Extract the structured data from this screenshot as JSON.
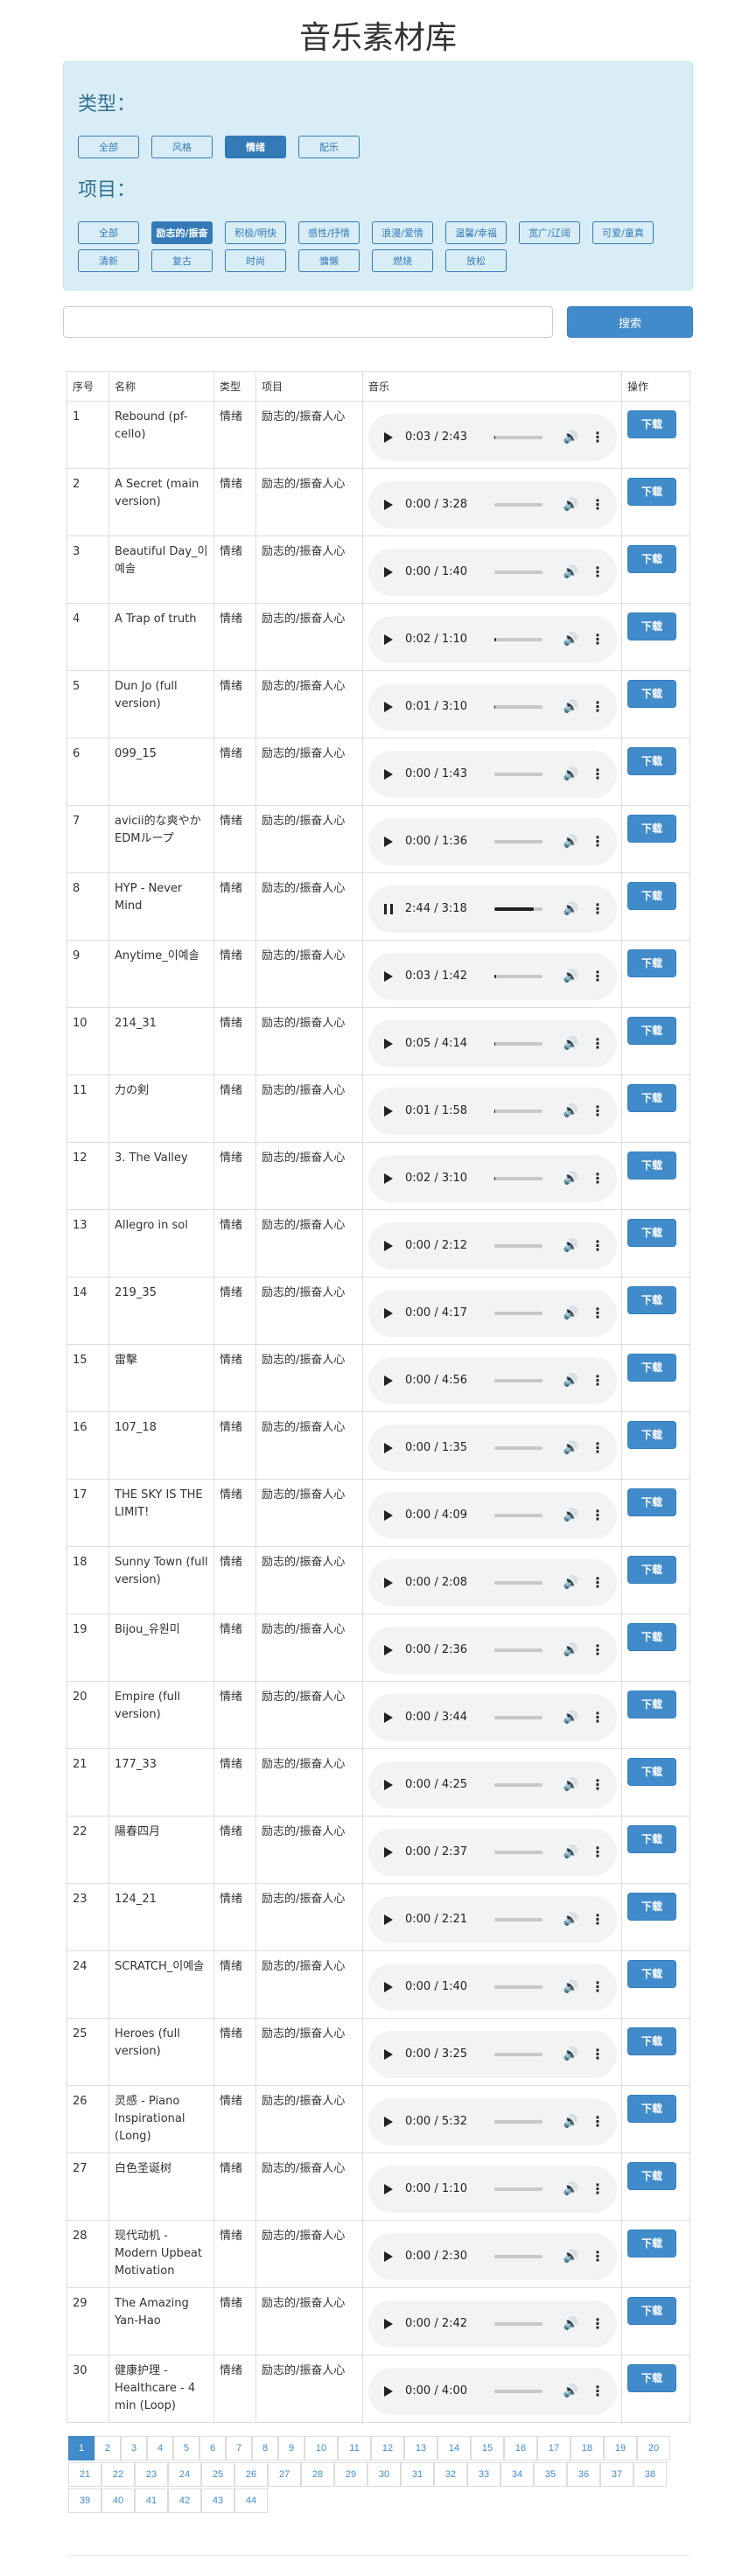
{
  "title": "音乐素材库",
  "filters": {
    "type_heading": "类型：",
    "type_chips": [
      {
        "label": "全部",
        "active": false
      },
      {
        "label": "风格",
        "active": false
      },
      {
        "label": "情绪",
        "active": true
      },
      {
        "label": "配乐",
        "active": false
      }
    ],
    "item_heading": "项目：",
    "item_chips_row1": [
      {
        "label": "全部",
        "active": false
      },
      {
        "label": "励志的/振奋",
        "active": true
      },
      {
        "label": "积极/明快",
        "active": false
      },
      {
        "label": "感性/抒情",
        "active": false
      },
      {
        "label": "浪漫/爱情",
        "active": false
      },
      {
        "label": "温馨/幸福",
        "active": false
      },
      {
        "label": "宽广/辽阔",
        "active": false
      },
      {
        "label": "可爱/童真",
        "active": false
      }
    ],
    "item_chips_row2": [
      {
        "label": "清新",
        "active": false
      },
      {
        "label": "复古",
        "active": false
      },
      {
        "label": "时尚",
        "active": false
      },
      {
        "label": "慵懒",
        "active": false
      },
      {
        "label": "燃烧",
        "active": false
      },
      {
        "label": "放松",
        "active": false
      }
    ]
  },
  "search": {
    "placeholder": "",
    "button_label": "搜索"
  },
  "table": {
    "headers": [
      "序号",
      "名称",
      "类型",
      "项目",
      "音乐",
      "操作"
    ],
    "download_label": "下载",
    "rows": [
      {
        "no": "1",
        "name": "Rebound (pf-cello)",
        "type": "情绪",
        "item": "励志的/振奋人心",
        "time": "0:03 / 2:43",
        "progress": 0.02,
        "playing": false
      },
      {
        "no": "2",
        "name": "A Secret (main version)",
        "type": "情绪",
        "item": "励志的/振奋人心",
        "time": "0:00 / 3:28",
        "progress": 0,
        "playing": false
      },
      {
        "no": "3",
        "name": "Beautiful Day_이예솔",
        "type": "情绪",
        "item": "励志的/振奋人心",
        "time": "0:00 / 1:40",
        "progress": 0,
        "playing": false
      },
      {
        "no": "4",
        "name": "A Trap of truth",
        "type": "情绪",
        "item": "励志的/振奋人心",
        "time": "0:02 / 1:10",
        "progress": 0.03,
        "playing": false
      },
      {
        "no": "5",
        "name": "Dun Jo (full version)",
        "type": "情绪",
        "item": "励志的/振奋人心",
        "time": "0:01 / 3:10",
        "progress": 0.01,
        "playing": false
      },
      {
        "no": "6",
        "name": "099_15",
        "type": "情绪",
        "item": "励志的/振奋人心",
        "time": "0:00 / 1:43",
        "progress": 0,
        "playing": false
      },
      {
        "no": "7",
        "name": "avicii的な爽やかEDMループ",
        "type": "情绪",
        "item": "励志的/振奋人心",
        "time": "0:00 / 1:36",
        "progress": 0,
        "playing": false
      },
      {
        "no": "8",
        "name": "HYP - Never Mind",
        "type": "情绪",
        "item": "励志的/振奋人心",
        "time": "2:44 / 3:18",
        "progress": 0.83,
        "playing": true
      },
      {
        "no": "9",
        "name": "Anytime_이예솔",
        "type": "情绪",
        "item": "励志的/振奋人心",
        "time": "0:03 / 1:42",
        "progress": 0.03,
        "playing": false
      },
      {
        "no": "10",
        "name": "214_31",
        "type": "情绪",
        "item": "励志的/振奋人心",
        "time": "0:05 / 4:14",
        "progress": 0.02,
        "playing": false
      },
      {
        "no": "11",
        "name": "力の剣",
        "type": "情绪",
        "item": "励志的/振奋人心",
        "time": "0:01 / 1:58",
        "progress": 0.01,
        "playing": false
      },
      {
        "no": "12",
        "name": "3. The Valley",
        "type": "情绪",
        "item": "励志的/振奋人心",
        "time": "0:02 / 3:10",
        "progress": 0.01,
        "playing": false
      },
      {
        "no": "13",
        "name": "Allegro in sol",
        "type": "情绪",
        "item": "励志的/振奋人心",
        "time": "0:00 / 2:12",
        "progress": 0,
        "playing": false
      },
      {
        "no": "14",
        "name": "219_35",
        "type": "情绪",
        "item": "励志的/振奋人心",
        "time": "0:00 / 4:17",
        "progress": 0,
        "playing": false
      },
      {
        "no": "15",
        "name": "雷擊",
        "type": "情绪",
        "item": "励志的/振奋人心",
        "time": "0:00 / 4:56",
        "progress": 0,
        "playing": false
      },
      {
        "no": "16",
        "name": "107_18",
        "type": "情绪",
        "item": "励志的/振奋人心",
        "time": "0:00 / 1:35",
        "progress": 0,
        "playing": false
      },
      {
        "no": "17",
        "name": "THE SKY IS THE LIMIT!",
        "type": "情绪",
        "item": "励志的/振奋人心",
        "time": "0:00 / 4:09",
        "progress": 0,
        "playing": false
      },
      {
        "no": "18",
        "name": "Sunny Town (full version)",
        "type": "情绪",
        "item": "励志的/振奋人心",
        "time": "0:00 / 2:08",
        "progress": 0,
        "playing": false
      },
      {
        "no": "19",
        "name": "Bijou_유원미",
        "type": "情绪",
        "item": "励志的/振奋人心",
        "time": "0:00 / 2:36",
        "progress": 0,
        "playing": false
      },
      {
        "no": "20",
        "name": "Empire (full version)",
        "type": "情绪",
        "item": "励志的/振奋人心",
        "time": "0:00 / 3:44",
        "progress": 0,
        "playing": false
      },
      {
        "no": "21",
        "name": "177_33",
        "type": "情绪",
        "item": "励志的/振奋人心",
        "time": "0:00 / 4:25",
        "progress": 0,
        "playing": false
      },
      {
        "no": "22",
        "name": "陽春四月",
        "type": "情绪",
        "item": "励志的/振奋人心",
        "time": "0:00 / 2:37",
        "progress": 0,
        "playing": false
      },
      {
        "no": "23",
        "name": "124_21",
        "type": "情绪",
        "item": "励志的/振奋人心",
        "time": "0:00 / 2:21",
        "progress": 0,
        "playing": false
      },
      {
        "no": "24",
        "name": "SCRATCH_이예솔",
        "type": "情绪",
        "item": "励志的/振奋人心",
        "time": "0:00 / 1:40",
        "progress": 0,
        "playing": false
      },
      {
        "no": "25",
        "name": "Heroes (full version)",
        "type": "情绪",
        "item": "励志的/振奋人心",
        "time": "0:00 / 3:25",
        "progress": 0,
        "playing": false
      },
      {
        "no": "26",
        "name": "灵感 - Piano Inspirational (Long)",
        "type": "情绪",
        "item": "励志的/振奋人心",
        "time": "0:00 / 5:32",
        "progress": 0,
        "playing": false
      },
      {
        "no": "27",
        "name": "白色圣诞树",
        "type": "情绪",
        "item": "励志的/振奋人心",
        "time": "0:00 / 1:10",
        "progress": 0,
        "playing": false
      },
      {
        "no": "28",
        "name": "现代动机 - Modern Upbeat Motivation",
        "type": "情绪",
        "item": "励志的/振奋人心",
        "time": "0:00 / 2:30",
        "progress": 0,
        "playing": false
      },
      {
        "no": "29",
        "name": "The Amazing Yan-Hao",
        "type": "情绪",
        "item": "励志的/振奋人心",
        "time": "0:00 / 2:42",
        "progress": 0,
        "playing": false
      },
      {
        "no": "30",
        "name": "健康护理 - Healthcare - 4 min (Loop)",
        "type": "情绪",
        "item": "励志的/振奋人心",
        "time": "0:00 / 4:00",
        "progress": 0,
        "playing": false
      }
    ]
  },
  "pagination": {
    "current": "1",
    "pages": [
      "1",
      "2",
      "3",
      "4",
      "5",
      "6",
      "7",
      "8",
      "9",
      "10",
      "11",
      "12",
      "13",
      "14",
      "15",
      "16",
      "17",
      "18",
      "19",
      "20",
      "21",
      "22",
      "23",
      "24",
      "25",
      "26",
      "27",
      "28",
      "29",
      "30",
      "31",
      "32",
      "33",
      "34",
      "35",
      "36",
      "37",
      "38",
      "39",
      "40",
      "41",
      "42",
      "43",
      "44"
    ]
  }
}
